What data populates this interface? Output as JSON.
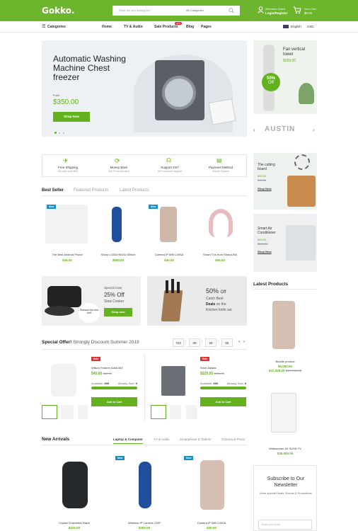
{
  "header": {
    "logo": "Gokko.",
    "search_placeholder": "What are you looking for?",
    "search_category": "All Categories",
    "account_line1": "Welcome Guest",
    "account_line2": "Login/Register",
    "cart_line1": "Your Cart",
    "cart_line2": "$0.00"
  },
  "nav": {
    "categories": "Categories",
    "items": [
      "Home",
      "TV & Audio",
      "Sale Products",
      "Blog",
      "Pages"
    ],
    "hot": "HOT",
    "language": "English",
    "currency": "USD"
  },
  "hero": {
    "title": "Automatic Washing Machine Chest freezer",
    "from": "From",
    "price": "$350.00",
    "button": "Shop Now"
  },
  "promo_right": {
    "fan_title": "Fan vertical tower",
    "fan_price": "$299.00",
    "badge_pct": "50%",
    "badge_off": "Off",
    "brand": "AUSTIN"
  },
  "features": [
    {
      "title": "Free Shipping",
      "sub": "All order over $99"
    },
    {
      "title": "Money Back",
      "sub": "100 % money back"
    },
    {
      "title": "Support 24/7",
      "sub": "24/7 customer support"
    },
    {
      "title": "Payment Method",
      "sub": "Secure System"
    }
  ],
  "tabs": [
    "Best Seller",
    "Featured Products",
    "Latest Products"
  ],
  "best_seller": [
    {
      "name": "The Best Android Phone",
      "price": "$45.00",
      "badge": "New"
    },
    {
      "name": "Sharp LC60LH510U 60inch",
      "price": "$550.00",
      "badge": ""
    },
    {
      "name": "Camera IP Wifi C40SA",
      "price": "$30.00",
      "badge": "New"
    },
    {
      "name": "Smart TVs from SharpUSA",
      "price": "$55.00",
      "badge": ""
    }
  ],
  "side_cards": [
    {
      "title": "The cutting board",
      "price": "$90.00",
      "old": "$95.00",
      "link": "Shop Now"
    },
    {
      "title": "Smart Air Conditioner",
      "price": "$99.00",
      "old": "$120.00",
      "link": "Shop Now"
    }
  ],
  "banner_cooker": {
    "line1": "Special now!",
    "pct": "25% Off",
    "name": "Slow Cooker",
    "button": "Shop now",
    "tag": "Release the best chef"
  },
  "banner_knife": {
    "pct": "50%",
    "off": "Off",
    "line1": "Catch Best",
    "line2": "Deals",
    "line3": "on the",
    "line4": "Kitchen knife set"
  },
  "latest_products": {
    "title": "Latest Products",
    "items": [
      {
        "name": "Bundle product",
        "price": "$6,090.00",
        "price2": "$47,328.00",
        "old": "$47,618.00"
      },
      {
        "name": "Widescreen 4K SUHD TV",
        "price": "$39,000.00"
      }
    ]
  },
  "special_offer": {
    "title": "Special Offer!",
    "sub": "Strongly Discount Summer 2019",
    "countdown": [
      "723",
      "08",
      "55",
      "05"
    ],
    "items": [
      {
        "name": "Wilson Federer Adult 887",
        "price": "$40.00",
        "old": "$65.00",
        "badge": "Sale",
        "available_label": "Available:",
        "available": "999",
        "sold_label": "Already Sold:",
        "sold": "0",
        "button": "Add to Cart"
      },
      {
        "name": "Shoe Adidas",
        "price": "$320.00",
        "old": "$550.00",
        "badge": "Sale",
        "available_label": "Available:",
        "available": "999",
        "sold_label": "Already Sold:",
        "sold": "0",
        "button": "Add to Cart"
      }
    ]
  },
  "new_arrivals": {
    "title": "New Arrivals",
    "tabs": [
      "Laptop & Computer",
      "TV & Audio",
      "Smartphone & Tablets",
      "Camera & Photo"
    ],
    "items": [
      {
        "name": "Crystal Chandelier Black",
        "price": "$100.00",
        "badge": ""
      },
      {
        "name": "Wireless IP Camera 720P",
        "price": "$350.00",
        "badge": "New"
      },
      {
        "name": "Camera IP Wifi C40SA",
        "price": "$30.00",
        "badge": "New"
      }
    ]
  },
  "newsletter": {
    "title": "Subscribe to Our Newsletter",
    "sub": "More special Deals, Events & Promotions",
    "placeholder": "Enter your email"
  }
}
